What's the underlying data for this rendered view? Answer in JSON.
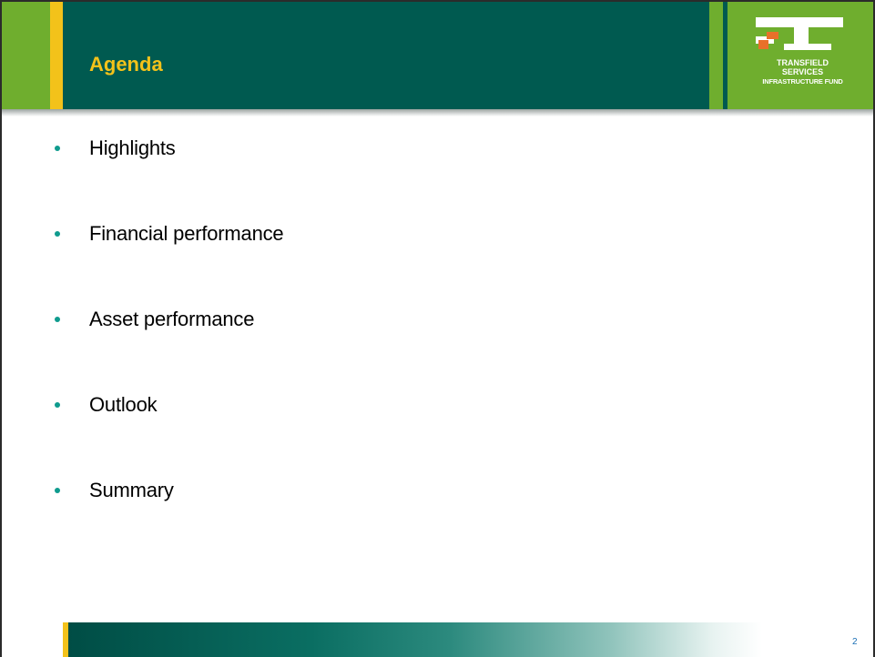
{
  "header": {
    "title": "Agenda",
    "logo": {
      "line1": "TRANSFIELD",
      "line2": "SERVICES",
      "line3": "INFRASTRUCTURE FUND"
    }
  },
  "agenda": {
    "items": [
      {
        "label": "Highlights"
      },
      {
        "label": "Financial performance"
      },
      {
        "label": "Asset performance"
      },
      {
        "label": "Outlook"
      },
      {
        "label": "Summary"
      }
    ]
  },
  "footer": {
    "page_number": "2"
  },
  "colors": {
    "header_teal": "#005a50",
    "accent_green": "#6fae2e",
    "accent_yellow": "#f3c21a",
    "bullet_teal": "#0f9b8e",
    "logo_orange": "#e8702a"
  }
}
